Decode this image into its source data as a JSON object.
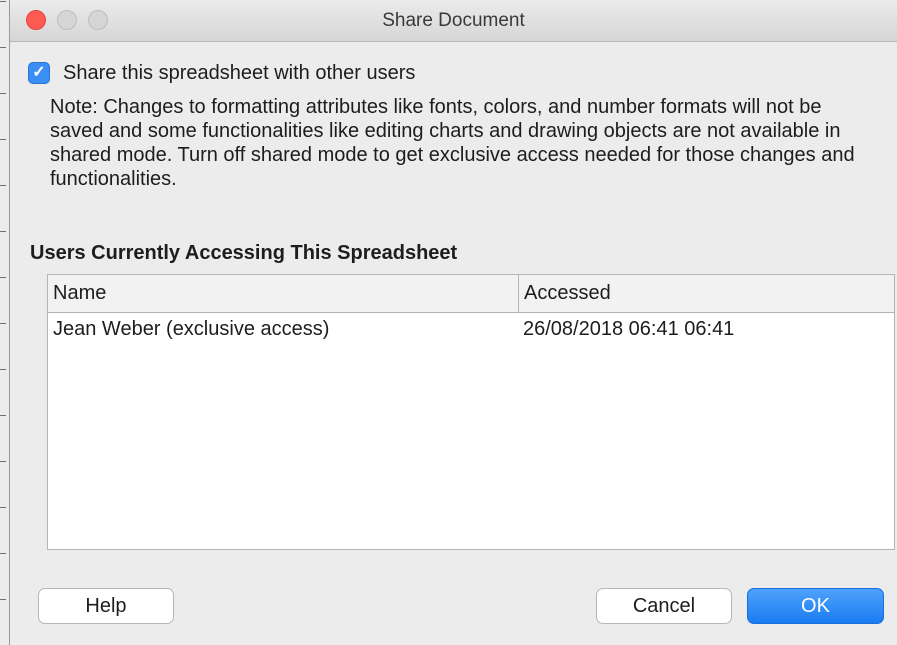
{
  "window": {
    "title": "Share Document"
  },
  "share": {
    "checked": true,
    "checkmark": "✓",
    "label": "Share this spreadsheet with other users"
  },
  "note": "Note: Changes to formatting attributes like fonts, colors, and number formats will not be saved and some functionalities like editing charts and drawing objects are not available in shared mode. Turn off shared mode to get exclusive access needed for those changes and functionalities.",
  "users": {
    "section_title": "Users Currently Accessing This Spreadsheet",
    "columns": [
      "Name",
      "Accessed"
    ],
    "rows": [
      {
        "name": "Jean Weber (exclusive access)",
        "accessed": "26/08/2018 06:41 06:41"
      }
    ]
  },
  "buttons": {
    "help": "Help",
    "cancel": "Cancel",
    "ok": "OK"
  },
  "colors": {
    "close": "#fd5a52",
    "accent": "#1a7cf2",
    "checkbox": "#3a8ef6"
  },
  "icons": {
    "close": "close-icon",
    "minimize": "minimize-icon",
    "maximize": "maximize-icon",
    "check": "checkmark-icon"
  }
}
